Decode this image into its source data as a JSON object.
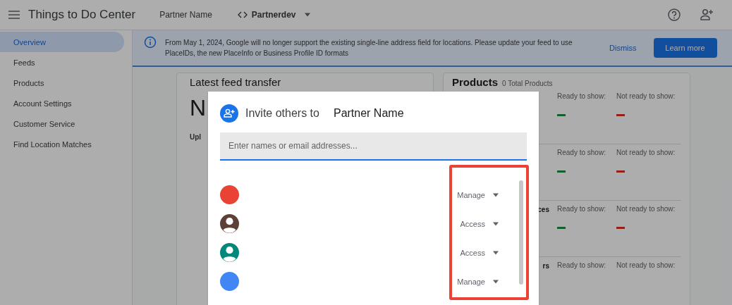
{
  "app_bar": {
    "title": "Things to Do Center",
    "partner": "Partner Name",
    "account": "Partnerdev"
  },
  "sidebar": {
    "items": [
      {
        "label": "Overview",
        "selected": true
      },
      {
        "label": "Feeds",
        "selected": false
      },
      {
        "label": "Products",
        "selected": false
      },
      {
        "label": "Account Settings",
        "selected": false
      },
      {
        "label": "Customer Service",
        "selected": false
      },
      {
        "label": "Find Location Matches",
        "selected": false
      }
    ]
  },
  "banner": {
    "text": "From May 1, 2024, Google will no longer support the existing single-line address field for locations. Please update your feed to use PlaceIDs, the new PlaceInfo or Business Profile ID formats",
    "dismiss": "Dismiss",
    "action": "Learn more"
  },
  "feed_card": {
    "title": "Latest feed transfer",
    "value": "N",
    "label": "Upl"
  },
  "products_card": {
    "title": "Products",
    "subtitle": "0 Total Products",
    "rows": [
      {
        "label": "",
        "ready": "Ready to show:",
        "not_ready": "Not ready to show:",
        "dashes": true
      },
      {
        "label": "",
        "ready": "Ready to show:",
        "not_ready": "Not ready to show:",
        "dashes": true
      },
      {
        "label": "ces",
        "ready": "Ready to show:",
        "not_ready": "Not ready to show:",
        "dashes": true
      },
      {
        "label": "rs",
        "ready": "Ready to show:",
        "not_ready": "Not ready to show:",
        "dashes": false
      }
    ]
  },
  "dialog": {
    "title": "Invite others to",
    "partner": "Partner Name",
    "placeholder": "Enter names or email addresses...",
    "people": [
      {
        "kind": "plain",
        "color": "#ea4335",
        "role": "Manage"
      },
      {
        "kind": "person",
        "color": "#5d4037",
        "role": "Access"
      },
      {
        "kind": "person",
        "color": "#00897b",
        "role": "Access"
      },
      {
        "kind": "plain",
        "color": "#4285f4",
        "role": "Manage"
      }
    ]
  }
}
